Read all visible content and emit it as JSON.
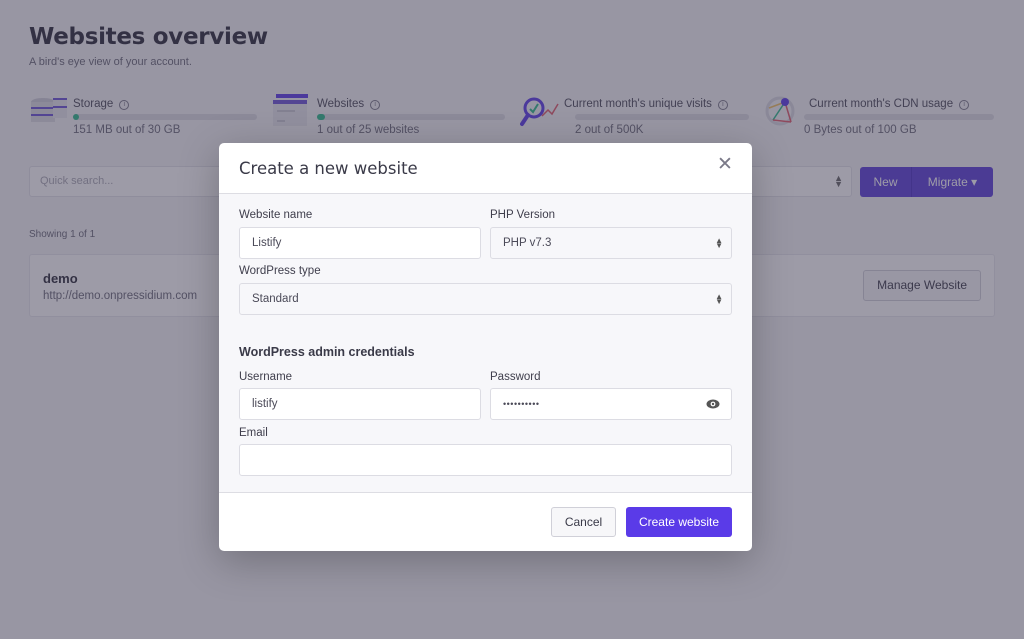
{
  "page": {
    "title": "Websites overview",
    "subtitle": "A bird's eye view of your account."
  },
  "stats": [
    {
      "icon": "storage-icon",
      "label": "Storage",
      "value": "151 MB out of 30 GB",
      "progress_percent": 0.5
    },
    {
      "icon": "websites-icon",
      "label": "Websites",
      "value": "1 out of 25 websites",
      "progress_percent": 4
    },
    {
      "icon": "analytics-icon",
      "label": "Current month's unique visits",
      "value": "2 out of 500K",
      "progress_percent": 0
    },
    {
      "icon": "cdn-icon",
      "label": "Current month's CDN usage",
      "value": "0 Bytes out of 100 GB",
      "progress_percent": 0
    }
  ],
  "toolbar": {
    "search_placeholder": "Quick search...",
    "new_label": "New",
    "migrate_label": "Migrate",
    "caret": "▾",
    "sort_arrows": "⬍"
  },
  "list": {
    "showing": "Showing 1 of 1",
    "sites": [
      {
        "name": "demo",
        "url": "http://demo.onpressidium.com",
        "action": "Manage Website"
      }
    ]
  },
  "modal": {
    "title": "Create a new website",
    "close_glyph": "✕",
    "fields": {
      "website_name": {
        "label": "Website name",
        "value": "Listify"
      },
      "php_version": {
        "label": "PHP Version",
        "value": "PHP v7.3"
      },
      "wordpress_type": {
        "label": "WordPress type",
        "value": "Standard"
      },
      "section_title": "WordPress admin credentials",
      "username": {
        "label": "Username",
        "value": "listify"
      },
      "password": {
        "label": "Password",
        "value": "••••••••••"
      },
      "email": {
        "label": "Email",
        "value": ""
      }
    },
    "cancel_label": "Cancel",
    "create_label": "Create website"
  },
  "colors": {
    "accent": "#5a3be8",
    "progress": "#2cbb8a",
    "overlay": "#3c3850"
  }
}
